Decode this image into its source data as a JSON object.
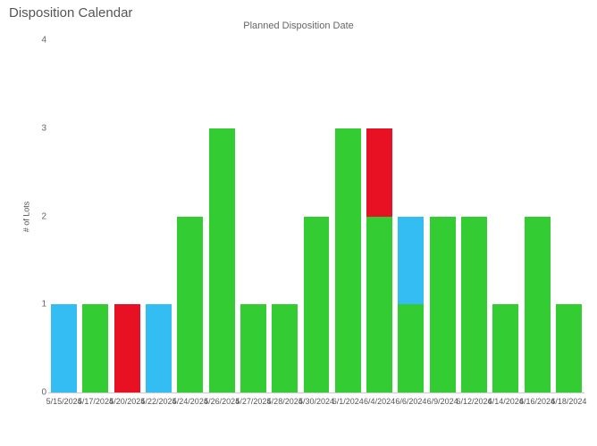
{
  "title": "Disposition Calendar",
  "subtitle": "Planned Disposition Date",
  "ylabel": "# of Lots",
  "yticks": [
    0,
    1,
    2,
    3,
    4
  ],
  "colors": {
    "green": "#33cc33",
    "blue": "#33bdf2",
    "red": "#e81123"
  },
  "xlabels_shown": [
    "5/15/2024",
    "5/17/2024",
    "5/20/2024",
    "5/22/2024",
    "5/24/2024",
    "5/26/2024",
    "5/27/2024",
    "5/28/2024",
    "5/30/2024",
    "6/1/2024",
    "6/4/2024",
    "6/6/2024",
    "6/9/2024",
    "6/12/2024",
    "6/14/2024",
    "6/16/2024",
    "6/18/2024"
  ],
  "chart_data": {
    "type": "bar",
    "stacked": true,
    "ylabel": "# of Lots",
    "ylim": [
      0,
      4
    ],
    "categories": [
      "5/15/2024",
      "5/17/2024",
      "5/20/2024",
      "5/22/2024",
      "5/24/2024",
      "5/26/2024",
      "5/27/2024",
      "5/28/2024",
      "5/30/2024",
      "6/1/2024",
      "6/4/2024",
      "6/6/2024",
      "6/9/2024",
      "6/12/2024",
      "6/14/2024",
      "6/16/2024",
      "6/18/2024"
    ],
    "series": [
      {
        "name": "green",
        "color": "#33cc33",
        "values": [
          0,
          1,
          0,
          0,
          2,
          3,
          1,
          1,
          2,
          3,
          2,
          1,
          2,
          2,
          1,
          2,
          1
        ]
      },
      {
        "name": "blue",
        "color": "#33bdf2",
        "values": [
          1,
          0,
          0,
          1,
          0,
          0,
          0,
          0,
          0,
          0,
          0,
          1,
          0,
          0,
          0,
          0,
          0
        ]
      },
      {
        "name": "red",
        "color": "#e81123",
        "values": [
          0,
          0,
          1,
          0,
          0,
          0,
          0,
          0,
          0,
          0,
          1,
          0,
          0,
          0,
          0,
          0,
          0
        ]
      }
    ]
  }
}
